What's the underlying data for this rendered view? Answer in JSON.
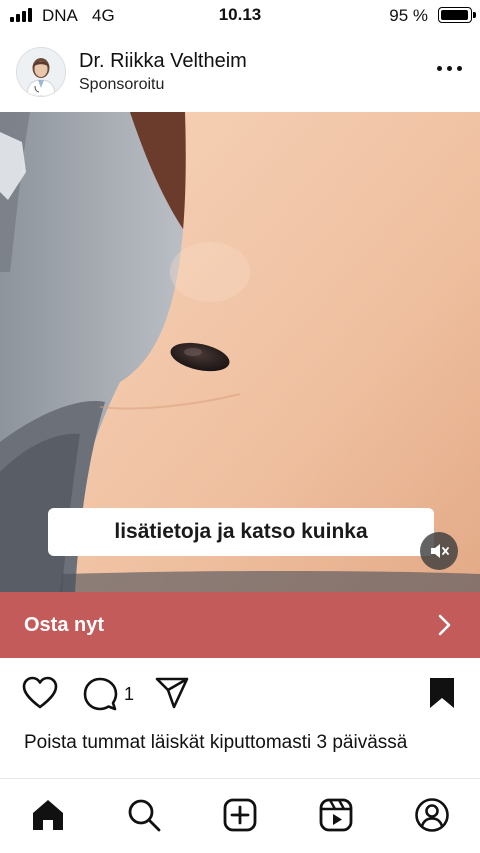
{
  "status_bar": {
    "carrier": "DNA",
    "network": "4G",
    "time": "10.13",
    "battery": "95 %"
  },
  "post": {
    "author": "Dr. Riikka Veltheim",
    "sponsored_label": "Sponsoroitu",
    "video_caption": "lisätietoja ja katso kuinka",
    "cta_label": "Osta nyt",
    "comment_count": "1",
    "caption": "Poista tummat läiskät kiputtomasti 3 päivässä"
  },
  "icons": {
    "more": "more-dots-icon",
    "mute": "speaker-muted-icon",
    "cta": "chevron-right-icon",
    "like": "heart-icon",
    "comment": "comment-bubble-icon",
    "share": "paper-plane-icon",
    "save": "bookmark-filled-icon",
    "nav": [
      "home-icon",
      "search-icon",
      "create-plus-icon",
      "reels-icon",
      "profile-icon"
    ]
  },
  "colors": {
    "cta_background": "#c35b5b",
    "text": "#111111"
  }
}
